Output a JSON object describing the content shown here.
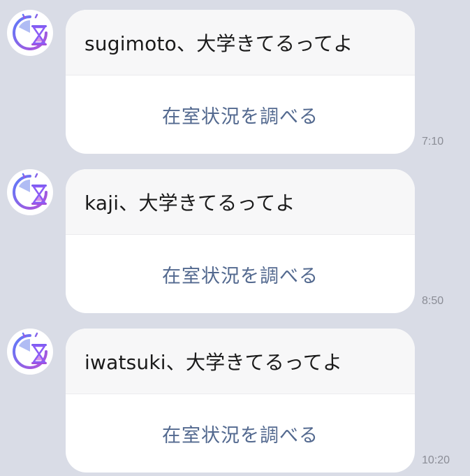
{
  "messages": [
    {
      "text": "sugimoto、大学きてるってよ",
      "action": "在室状況を調べる",
      "time": "7:10"
    },
    {
      "text": "kaji、大学きてるってよ",
      "action": "在室状況を調べる",
      "time": "8:50"
    },
    {
      "text": "iwatsuki、大学きてるってよ",
      "action": "在室状況を調べる",
      "time": "10:20"
    }
  ],
  "colors": {
    "background": "#d9dce6",
    "action_text": "#53698f",
    "avatar_accent": "#8b5cf6"
  }
}
